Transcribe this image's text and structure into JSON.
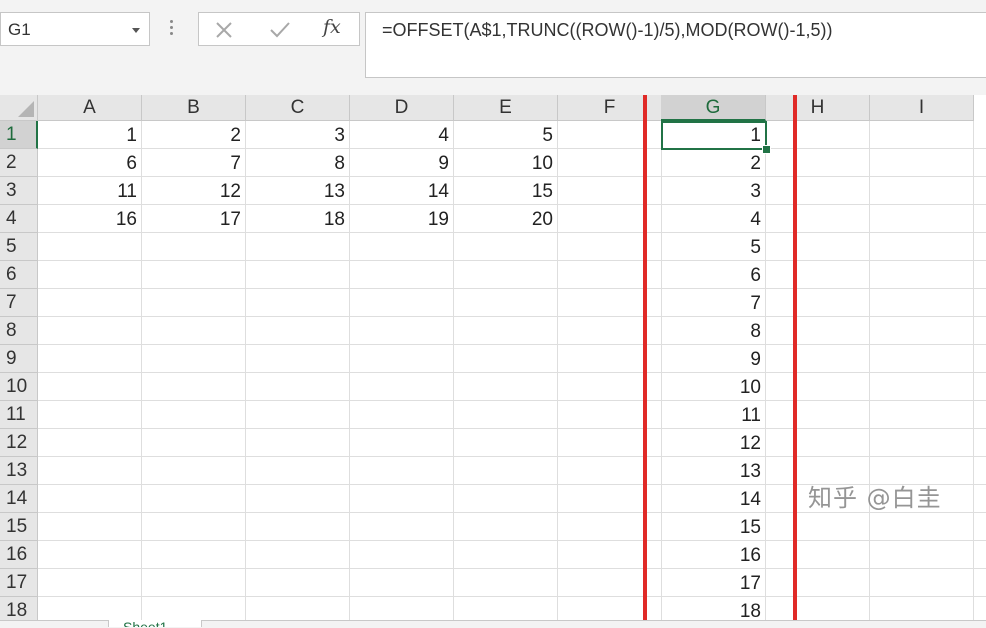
{
  "name_box": {
    "value": "G1"
  },
  "formula_bar": {
    "cancel_icon": "close-icon",
    "enter_icon": "check-icon",
    "fx_label": "fx",
    "formula": "=OFFSET(A$1,TRUNC((ROW()-1)/5),MOD(ROW()-1,5))"
  },
  "columns": [
    "A",
    "B",
    "C",
    "D",
    "E",
    "F",
    "G",
    "H",
    "I"
  ],
  "selected_column": "G",
  "rows": [
    "1",
    "2",
    "3",
    "4",
    "5",
    "6",
    "7",
    "8",
    "9",
    "10",
    "11",
    "12",
    "13",
    "14",
    "15",
    "16",
    "17",
    "18"
  ],
  "selected_row": "1",
  "cells": {
    "A": [
      "1",
      "6",
      "11",
      "16"
    ],
    "B": [
      "2",
      "7",
      "12",
      "17"
    ],
    "C": [
      "3",
      "8",
      "13",
      "18"
    ],
    "D": [
      "4",
      "9",
      "14",
      "19"
    ],
    "E": [
      "5",
      "10",
      "15",
      "20"
    ],
    "G": [
      "1",
      "2",
      "3",
      "4",
      "5",
      "6",
      "7",
      "8",
      "9",
      "10",
      "11",
      "12",
      "13",
      "14",
      "15",
      "16",
      "17",
      "18"
    ]
  },
  "active_cell": "G1",
  "highlight_color": "#e02a27",
  "accent_color": "#217346",
  "watermark": "知乎 @白圭",
  "sheet_tab": {
    "label": "Sheet1"
  }
}
